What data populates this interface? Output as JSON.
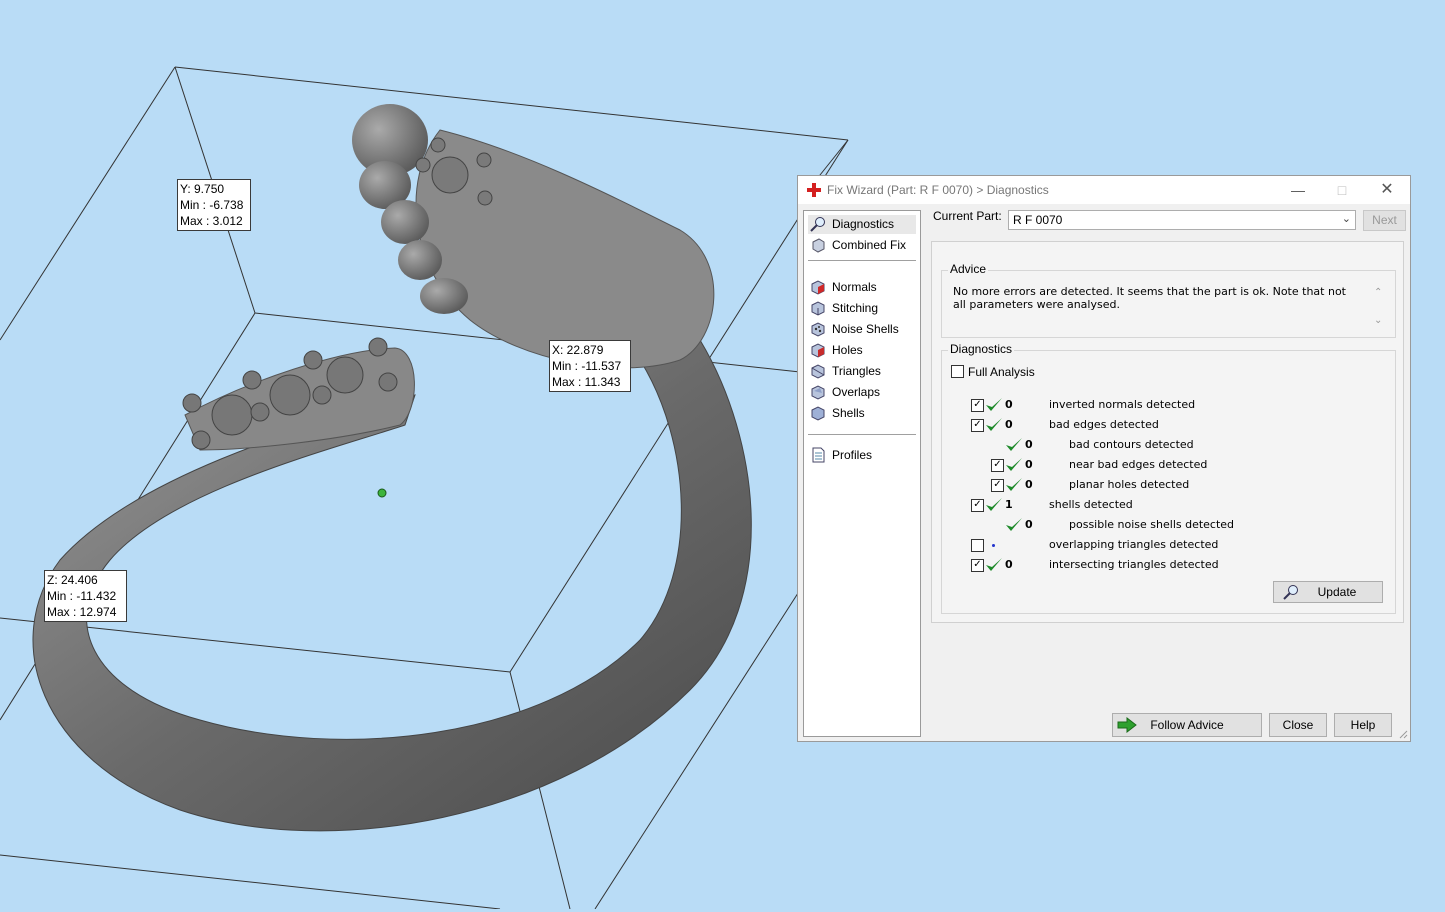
{
  "viewport": {
    "background": "#b9dcf6",
    "y_readout": {
      "value": "Y: 9.750",
      "min": "Min : -6.738",
      "max": "Max : 3.012"
    },
    "x_readout": {
      "value": "X: 22.879",
      "min": "Min : -11.537",
      "max": "Max : 11.343"
    },
    "z_readout": {
      "value": "Z: 24.406",
      "min": "Min : -11.432",
      "max": "Max : 12.974"
    }
  },
  "dialog": {
    "title": "Fix Wizard (Part: R F 0070) > Diagnostics",
    "nav": {
      "items": [
        {
          "label": "Diagnostics",
          "icon": "magnifier-icon"
        },
        {
          "label": "Combined Fix",
          "icon": "cube-icon"
        },
        {
          "label": "Normals",
          "icon": "normals-cube-icon"
        },
        {
          "label": "Stitching",
          "icon": "stitching-cube-icon"
        },
        {
          "label": "Noise Shells",
          "icon": "noise-shells-icon"
        },
        {
          "label": "Holes",
          "icon": "holes-cube-icon"
        },
        {
          "label": "Triangles",
          "icon": "triangles-cube-icon"
        },
        {
          "label": "Overlaps",
          "icon": "overlaps-cube-icon"
        },
        {
          "label": "Shells",
          "icon": "shells-cube-icon"
        },
        {
          "label": "Profiles",
          "icon": "document-icon"
        }
      ]
    },
    "current_part_label": "Current Part:",
    "current_part_value": "R F 0070",
    "next_label": "Next",
    "advice": {
      "legend": "Advice",
      "text": "No more errors are detected. It seems that the part is ok. Note that not all parameters were analysed."
    },
    "diagnostics": {
      "legend": "Diagnostics",
      "full_analysis_label": "Full Analysis",
      "full_analysis_checked": false,
      "rows": [
        {
          "checkbox": "checked",
          "status": "ok",
          "count": "0",
          "label": "inverted normals detected",
          "indent": 0
        },
        {
          "checkbox": "checked",
          "status": "ok",
          "count": "0",
          "label": "bad edges detected",
          "indent": 0
        },
        {
          "checkbox": "none",
          "status": "ok",
          "count": "0",
          "label": "bad contours detected",
          "indent": 1
        },
        {
          "checkbox": "checked",
          "status": "ok",
          "count": "0",
          "label": "near bad edges detected",
          "indent": 1
        },
        {
          "checkbox": "checked",
          "status": "ok",
          "count": "0",
          "label": "planar holes detected",
          "indent": 1
        },
        {
          "checkbox": "checked",
          "status": "ok",
          "count": "1",
          "label": "shells detected",
          "indent": 0
        },
        {
          "checkbox": "none",
          "status": "ok",
          "count": "0",
          "label": "possible noise shells detected",
          "indent": 1
        },
        {
          "checkbox": "unchecked",
          "status": "dot",
          "count": "",
          "label": "overlapping triangles detected",
          "indent": 0
        },
        {
          "checkbox": "checked",
          "status": "ok",
          "count": "0",
          "label": "intersecting triangles detected",
          "indent": 0
        }
      ],
      "update_label": "Update"
    },
    "buttons": {
      "follow_advice": "Follow Advice",
      "close": "Close",
      "help": "Help"
    },
    "colors": {
      "tick": "#1e8a2a",
      "follow_arrow": "#2ea02e"
    }
  }
}
